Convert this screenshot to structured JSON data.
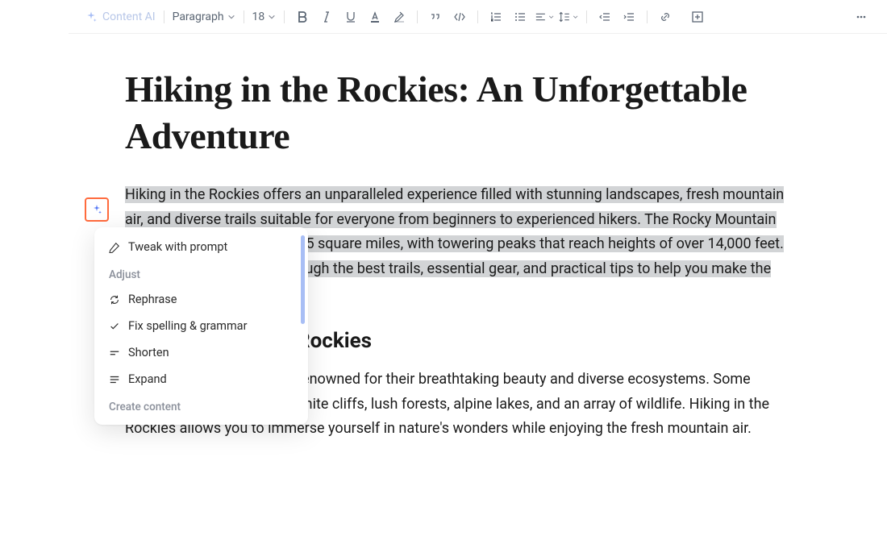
{
  "toolbar": {
    "content_ai_label": "Content AI",
    "style_select": "Paragraph",
    "font_size": "18"
  },
  "document": {
    "title": "Hiking in the Rockies: An Unforgettable Adventure",
    "para1": "Hiking in the Rockies offers an unparalleled experience filled with stunning landscapes, fresh mountain air, and diverse trails suitable for everyone from beginners to experienced hikers. The Rocky Mountain National Park spans over 415 square miles, with towering peaks that reach heights of over 14,000 feet. This post will guide you through the best trails, essential gear, and practical tips to help you make the most of your adventure",
    "h2": "The Beauty of the Rockies",
    "para2": "The American Rockies are renowned for their breathtaking beauty and diverse ecosystems. Some notable features include granite cliffs, lush forests, alpine lakes, and an array of wildlife. Hiking in the Rockies allows you to immerse yourself in nature's wonders while enjoying the fresh mountain air."
  },
  "ai_menu": {
    "tweak": "Tweak with prompt",
    "adjust_header": "Adjust",
    "rephrase": "Rephrase",
    "fix": "Fix spelling & grammar",
    "shorten": "Shorten",
    "expand": "Expand",
    "create_header": "Create content"
  }
}
